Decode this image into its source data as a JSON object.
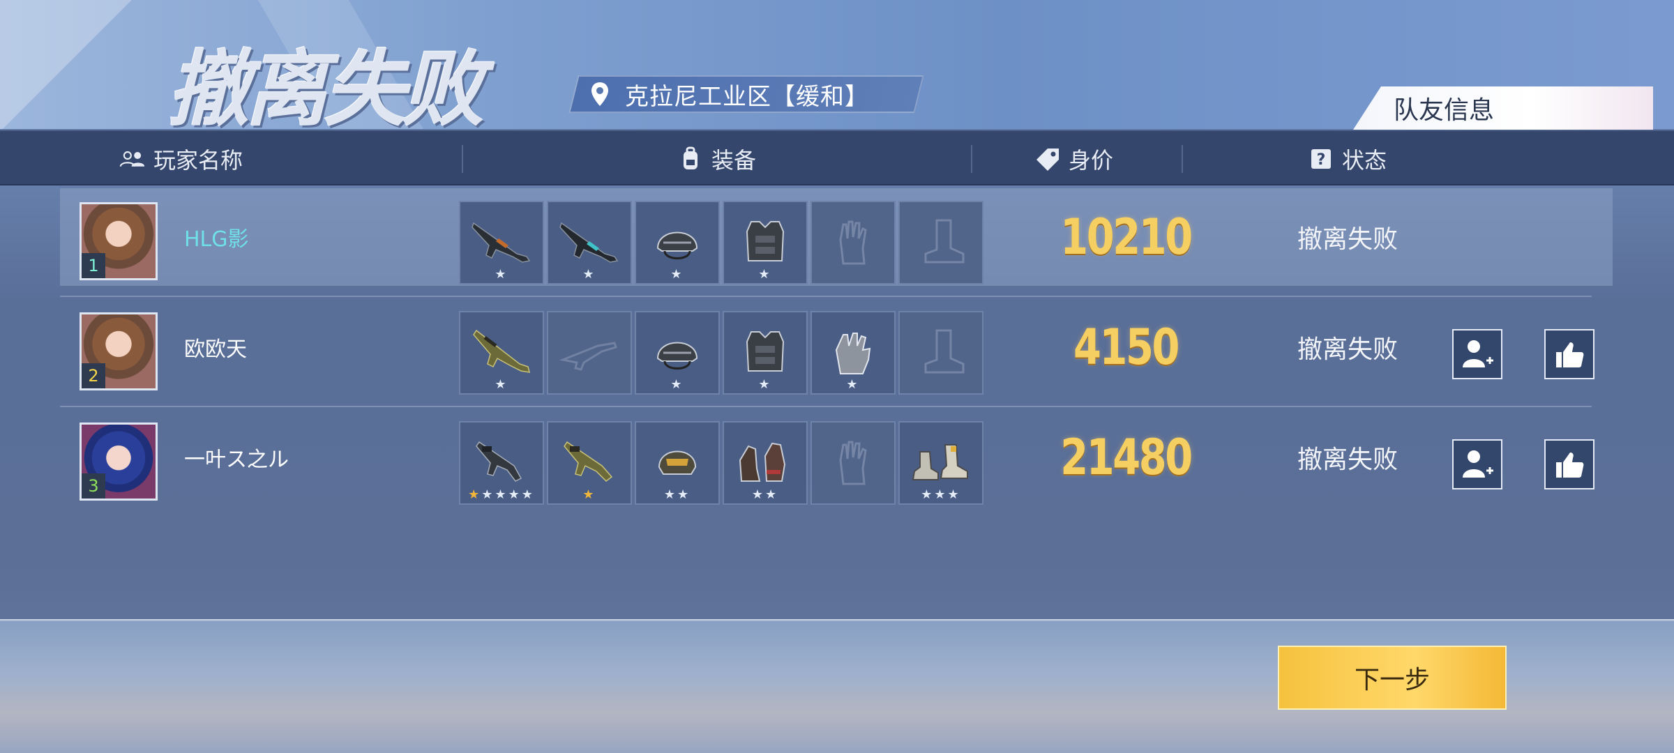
{
  "title": "撤离失败",
  "location": "克拉尼工业区【缓和】",
  "teammate_tab": "队友信息",
  "columns": {
    "player": "玩家名称",
    "equipment": "装备",
    "value": "身价",
    "status": "状态"
  },
  "players": [
    {
      "rank": "1",
      "name": "HLG影",
      "value": "10210",
      "status": "撤离失败",
      "slots": [
        {
          "item": "rifle-icon",
          "stars": "★"
        },
        {
          "item": "rifle-icon",
          "stars": "★"
        },
        {
          "item": "helmet-icon",
          "stars": "★"
        },
        {
          "item": "armor-vest-icon",
          "stars": "★"
        },
        {
          "item": "glove-empty-icon",
          "stars": ""
        },
        {
          "item": "boot-empty-icon",
          "stars": ""
        }
      ]
    },
    {
      "rank": "2",
      "name": "欧欧天",
      "value": "4150",
      "status": "撤离失败",
      "slots": [
        {
          "item": "rifle-icon",
          "stars": "★"
        },
        {
          "item": "rifle-empty-icon",
          "stars": ""
        },
        {
          "item": "helmet-icon",
          "stars": "★"
        },
        {
          "item": "armor-vest-icon",
          "stars": "★"
        },
        {
          "item": "glove-icon",
          "stars": "★"
        },
        {
          "item": "boot-empty-icon",
          "stars": ""
        }
      ]
    },
    {
      "rank": "3",
      "name": "一叶ス之ル",
      "value": "21480",
      "status": "撤离失败",
      "slots": [
        {
          "item": "smg-icon",
          "stars": "★★★★★",
          "gold": 1
        },
        {
          "item": "smg-icon",
          "stars": "★",
          "gold": 1
        },
        {
          "item": "helmet-icon",
          "stars": "★★"
        },
        {
          "item": "gloves-pair-icon",
          "stars": "★★"
        },
        {
          "item": "glove-empty-icon",
          "stars": ""
        },
        {
          "item": "boots-icon",
          "stars": "★★★"
        }
      ]
    }
  ],
  "next_button": "下一步",
  "colors": {
    "value_gold": "#f6cf62",
    "self_name": "#6fe0e8",
    "button_yellow": "#f6c23e",
    "header_bar": "#34466b"
  }
}
